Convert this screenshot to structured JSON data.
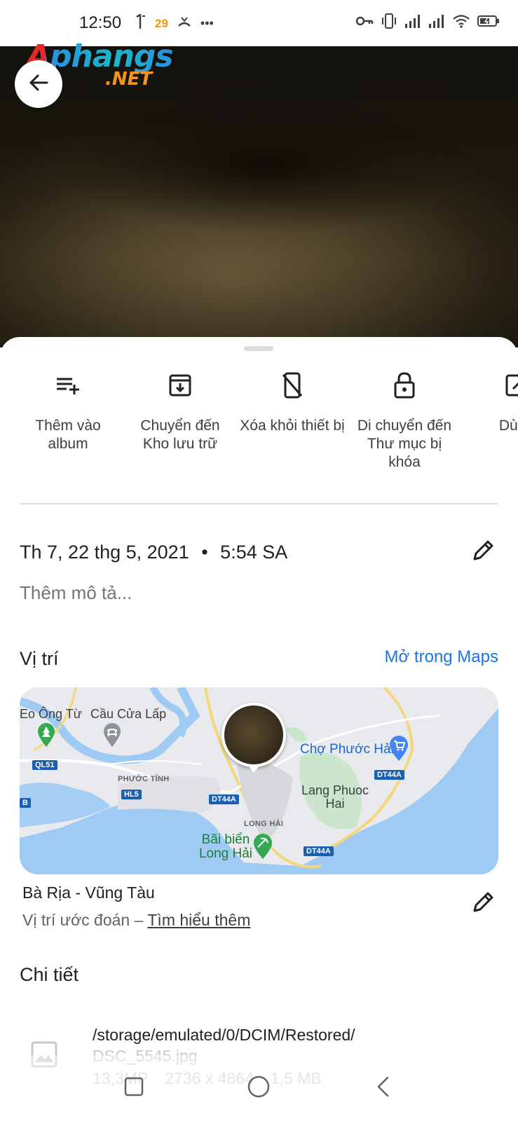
{
  "status_bar": {
    "time": "12:50",
    "badge": "29",
    "more": "•••"
  },
  "watermark": {
    "top": "Aphangs",
    "bottom": ".NET"
  },
  "actions": [
    {
      "label": "Thêm vào album",
      "icon": "playlist-add-icon"
    },
    {
      "label": "Chuyển đến Kho lưu trữ",
      "icon": "archive-icon"
    },
    {
      "label": "Xóa khỏi thiết bị",
      "icon": "phone-remove-icon"
    },
    {
      "label": "Di chuyển đến Thư mục bị khóa",
      "icon": "lock-icon"
    },
    {
      "label": "Dùng",
      "icon": "open-external-icon"
    }
  ],
  "info": {
    "date": "Th 7, 22 thg 5, 2021",
    "separator": "•",
    "time": "5:54 SA",
    "description_placeholder": "Thêm mô tả..."
  },
  "location": {
    "title": "Vị trí",
    "open_maps": "Mở trong Maps",
    "place": "Bà Rịa - Vũng Tàu",
    "estimated": "Vị trí ước đoán –",
    "learn_more": "Tìm hiểu thêm"
  },
  "map": {
    "labels": {
      "eo_ong_tu": "Eo Ông Từ",
      "cau_cua_lap": "Cầu Cửa Lấp",
      "phuoc_tinh": "PHƯỚC TỈNH",
      "cho_phuoc_hai": "Chợ Phước Hải",
      "lang_phuoc_hai": "Lang Phuoc Hai",
      "long_hai": "LONG HẢI",
      "bai_bien": "Bãi biển Long Hải"
    },
    "road_signs": [
      "QL51",
      "HL5",
      "DT44A",
      "DT44A",
      "DT44A",
      "B"
    ]
  },
  "details": {
    "title": "Chi tiết",
    "path": "/storage/emulated/0/DCIM/Restored/",
    "filename": "DSC_5545.jpg",
    "megapixels": "13,3MP",
    "resolution": "2736 x 4864",
    "size": "1,5 MB"
  }
}
